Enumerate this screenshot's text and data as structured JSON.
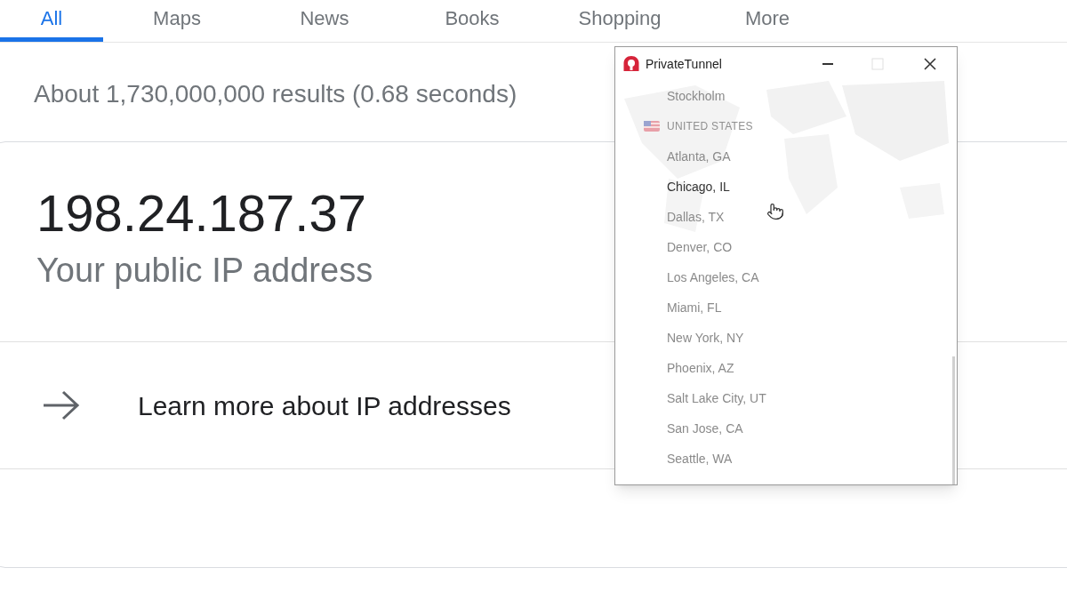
{
  "tabs": [
    {
      "label": "All",
      "selected": true
    },
    {
      "label": "Maps",
      "selected": false
    },
    {
      "label": "News",
      "selected": false
    },
    {
      "label": "Books",
      "selected": false
    },
    {
      "label": "Shopping",
      "selected": false
    },
    {
      "label": "More",
      "selected": false
    }
  ],
  "result_stats": "About 1,730,000,000 results (0.68 seconds)",
  "ip_card": {
    "ip": "198.24.187.37",
    "caption": "Your public IP address",
    "link": "Learn more about IP addresses"
  },
  "vpn_window": {
    "title": "PrivateTunnel",
    "locations": [
      {
        "kind": "city",
        "label": "Stockholm",
        "highlighted": false
      },
      {
        "kind": "country",
        "label": "UNITED STATES"
      },
      {
        "kind": "city",
        "label": "Atlanta, GA",
        "highlighted": false
      },
      {
        "kind": "city",
        "label": "Chicago, IL",
        "highlighted": true
      },
      {
        "kind": "city",
        "label": "Dallas, TX",
        "highlighted": false
      },
      {
        "kind": "city",
        "label": "Denver, CO",
        "highlighted": false
      },
      {
        "kind": "city",
        "label": "Los Angeles, CA",
        "highlighted": false
      },
      {
        "kind": "city",
        "label": "Miami, FL",
        "highlighted": false
      },
      {
        "kind": "city",
        "label": "New York, NY",
        "highlighted": false
      },
      {
        "kind": "city",
        "label": "Phoenix, AZ",
        "highlighted": false
      },
      {
        "kind": "city",
        "label": "Salt Lake City, UT",
        "highlighted": false
      },
      {
        "kind": "city",
        "label": "San Jose, CA",
        "highlighted": false
      },
      {
        "kind": "city",
        "label": "Seattle, WA",
        "highlighted": false
      }
    ]
  }
}
